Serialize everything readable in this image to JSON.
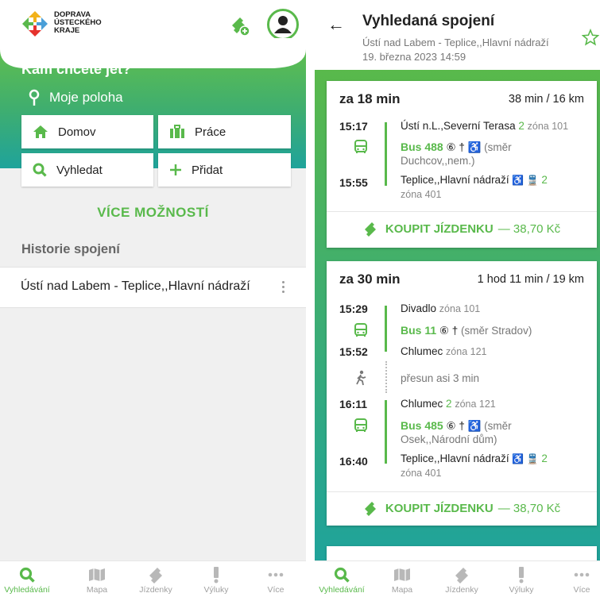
{
  "left": {
    "brand": [
      "DOPRAVA",
      "ÚSTECKÉHO",
      "KRAJE"
    ],
    "hero_title": "Kam chcete jet?",
    "location": "Moje poloha",
    "quick": {
      "home": "Domov",
      "work": "Práce",
      "search": "Vyhledat",
      "add": "Přidat"
    },
    "more_options": "VÍCE MOŽNOSTÍ",
    "history_title": "Historie spojení",
    "history_items": [
      "Ústí nad Labem - Teplice,,Hlavní nádraží"
    ]
  },
  "nav": {
    "search": "Vyhledávání",
    "map": "Mapa",
    "tickets": "Jízdenky",
    "outages": "Výluky",
    "more": "Více"
  },
  "right": {
    "title": "Vyhledaná spojení",
    "route": "Ústí nad Labem - Teplice,,Hlavní nádraží",
    "datetime": "19. března 2023 14:59",
    "connections": [
      {
        "in": "za 18 min",
        "duration": "38 min / 16 km",
        "dep_time": "15:17",
        "dep_stop": "Ústí n.L.,Severní Terasa",
        "dep_platform": "2",
        "dep_zone": "zóna 101",
        "line": "Bus 488",
        "line_symbols": "⑥ † ♿",
        "direction": "(směr Duchcov,,nem.)",
        "arr_time": "15:55",
        "arr_stop": "Teplice,,Hlavní nádraží",
        "arr_symbols": "♿ 🚆",
        "arr_platform": "2",
        "arr_zone": "zóna 401",
        "buy_label": "KOUPIT JÍZDENKU",
        "price": "— 38,70 Kč"
      },
      {
        "in": "za 30 min",
        "duration": "1 hod 11 min / 19 km",
        "s1_time": "15:29",
        "s1_stop": "Divadlo",
        "s1_zone": "zóna 101",
        "line1": "Bus 11",
        "line1_symbols": "⑥ †",
        "line1_dir": "(směr Stradov)",
        "s2_time": "15:52",
        "s2_stop": "Chlumec",
        "s2_zone": "zóna 121",
        "walk": "přesun asi 3 min",
        "s3_time": "16:11",
        "s3_stop": "Chlumec",
        "s3_platform": "2",
        "s3_zone": "zóna 121",
        "line2": "Bus 485",
        "line2_symbols": "⑥ † ♿",
        "line2_dir": "(směr Osek,,Národní dům)",
        "s4_time": "16:40",
        "s4_stop": "Teplice,,Hlavní nádraží",
        "s4_symbols": "♿ 🚆",
        "s4_platform": "2",
        "s4_zone": "zóna 401",
        "buy_label": "KOUPIT JÍZDENKU",
        "price": "— 38,70 Kč"
      }
    ]
  },
  "colors": {
    "accent": "#59b94b",
    "teal": "#1fa39b"
  }
}
